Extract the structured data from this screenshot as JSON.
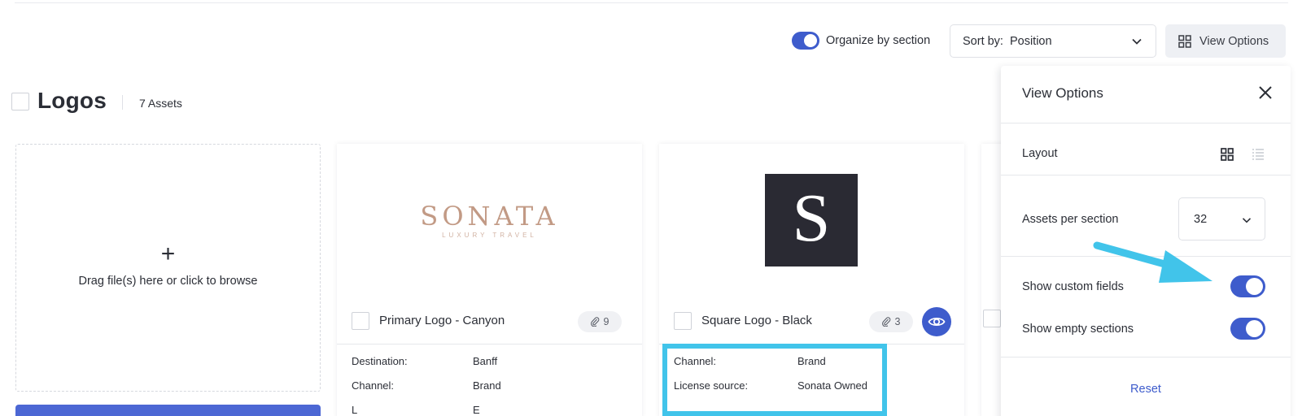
{
  "toolbar": {
    "organize_label": "Organize by section",
    "organize_on": true,
    "sort_prefix": "Sort by:",
    "sort_value": "Position",
    "view_options_label": "View Options"
  },
  "section": {
    "title": "Logos",
    "count": "7 Assets"
  },
  "upload": {
    "plus": "+",
    "text": "Drag file(s) here or click to browse"
  },
  "cards": [
    {
      "name": "Primary Logo - Canyon",
      "attachments": "9",
      "logo_word": "SONATA",
      "logo_sub": "LUXURY TRAVEL",
      "fields": [
        {
          "label": "Destination:",
          "value": "Banff"
        },
        {
          "label": "Channel:",
          "value": "Brand"
        },
        {
          "label": "L",
          "value": "E"
        }
      ]
    },
    {
      "name": "Square Logo - Black",
      "attachments": "3",
      "logo_letter": "S",
      "fields": [
        {
          "label": "Channel:",
          "value": "Brand"
        },
        {
          "label": "License source:",
          "value": "Sonata Owned"
        }
      ]
    }
  ],
  "panel": {
    "title": "View Options",
    "layout_label": "Layout",
    "assets_label": "Assets per section",
    "assets_value": "32",
    "custom_fields_label": "Show custom fields",
    "custom_fields_on": true,
    "empty_sections_label": "Show empty sections",
    "empty_sections_on": true,
    "reset_label": "Reset"
  },
  "colors": {
    "accent": "#3e5ccc",
    "highlight": "#41c4ea",
    "arrow": "#41c4ea"
  },
  "icons": {
    "view_options": "grid-icon",
    "close": "close-icon",
    "attachments": "paperclip-icon",
    "preview": "eye-icon"
  }
}
